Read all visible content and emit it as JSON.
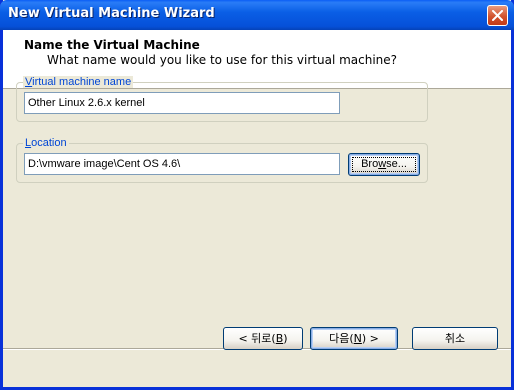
{
  "window": {
    "title": "New Virtual Machine Wizard"
  },
  "header": {
    "title": "Name the Virtual Machine",
    "subtitle": "What name would you like to use for this virtual machine?"
  },
  "vm_name_group": {
    "label_accel": "V",
    "label_rest": "irtual machine name",
    "value": "Other Linux 2.6.x kernel"
  },
  "location_group": {
    "label_accel": "L",
    "label_rest": "ocation",
    "value": "D:\\vmware image\\Cent OS 4.6\\",
    "browse_accel": "w",
    "browse_before": "Bro",
    "browse_after": "se..."
  },
  "footer": {
    "back_before": "< 뒤로(",
    "back_accel": "B",
    "back_after": ")",
    "next_before": "다음(",
    "next_accel": "N",
    "next_after": ") >",
    "cancel_label": "취소"
  }
}
